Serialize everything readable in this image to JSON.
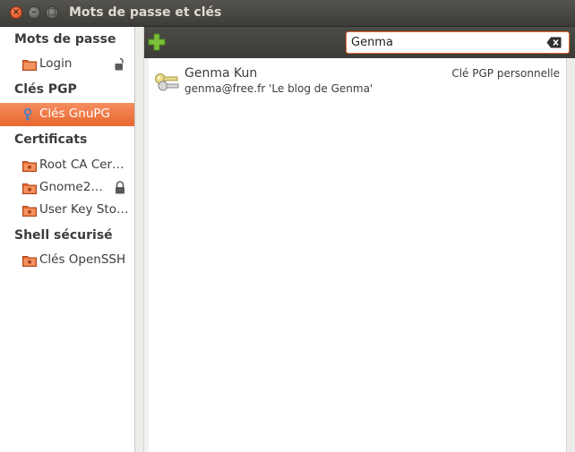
{
  "window": {
    "title": "Mots de passe et clés",
    "close_glyph": "×",
    "minimize_glyph": "–",
    "maximize_glyph": "□"
  },
  "sidebar": {
    "sections": [
      {
        "header": "Mots de passe",
        "items": [
          {
            "label": "Login",
            "icon": "folder-icon",
            "locked": true
          }
        ]
      },
      {
        "header": "Clés PGP",
        "items": [
          {
            "label": "Clés GnuPG",
            "icon": "key-icon",
            "selected": true
          }
        ]
      },
      {
        "header": "Certificats",
        "items": [
          {
            "label": "Root CA Cer…",
            "icon": "folder-icon"
          },
          {
            "label": "Gnome2…",
            "icon": "folder-icon",
            "locked": true
          },
          {
            "label": "User Key Sto…",
            "icon": "folder-icon"
          }
        ]
      },
      {
        "header": "Shell sécurisé",
        "items": [
          {
            "label": "Clés OpenSSH",
            "icon": "folder-icon"
          }
        ]
      }
    ]
  },
  "toolbar": {
    "add_icon": "plus-icon",
    "search_value": "Genma",
    "clear_icon": "clear-text-icon"
  },
  "keys": [
    {
      "name": "Genma Kun",
      "detail": "genma@free.fr 'Le blog de Genma'",
      "type": "Clé PGP personnelle",
      "icon": "pgp-keypair-icon"
    }
  ],
  "colors": {
    "accent": "#e9672f",
    "titlebar": "#3c3b37",
    "text": "#3c3c3c"
  }
}
